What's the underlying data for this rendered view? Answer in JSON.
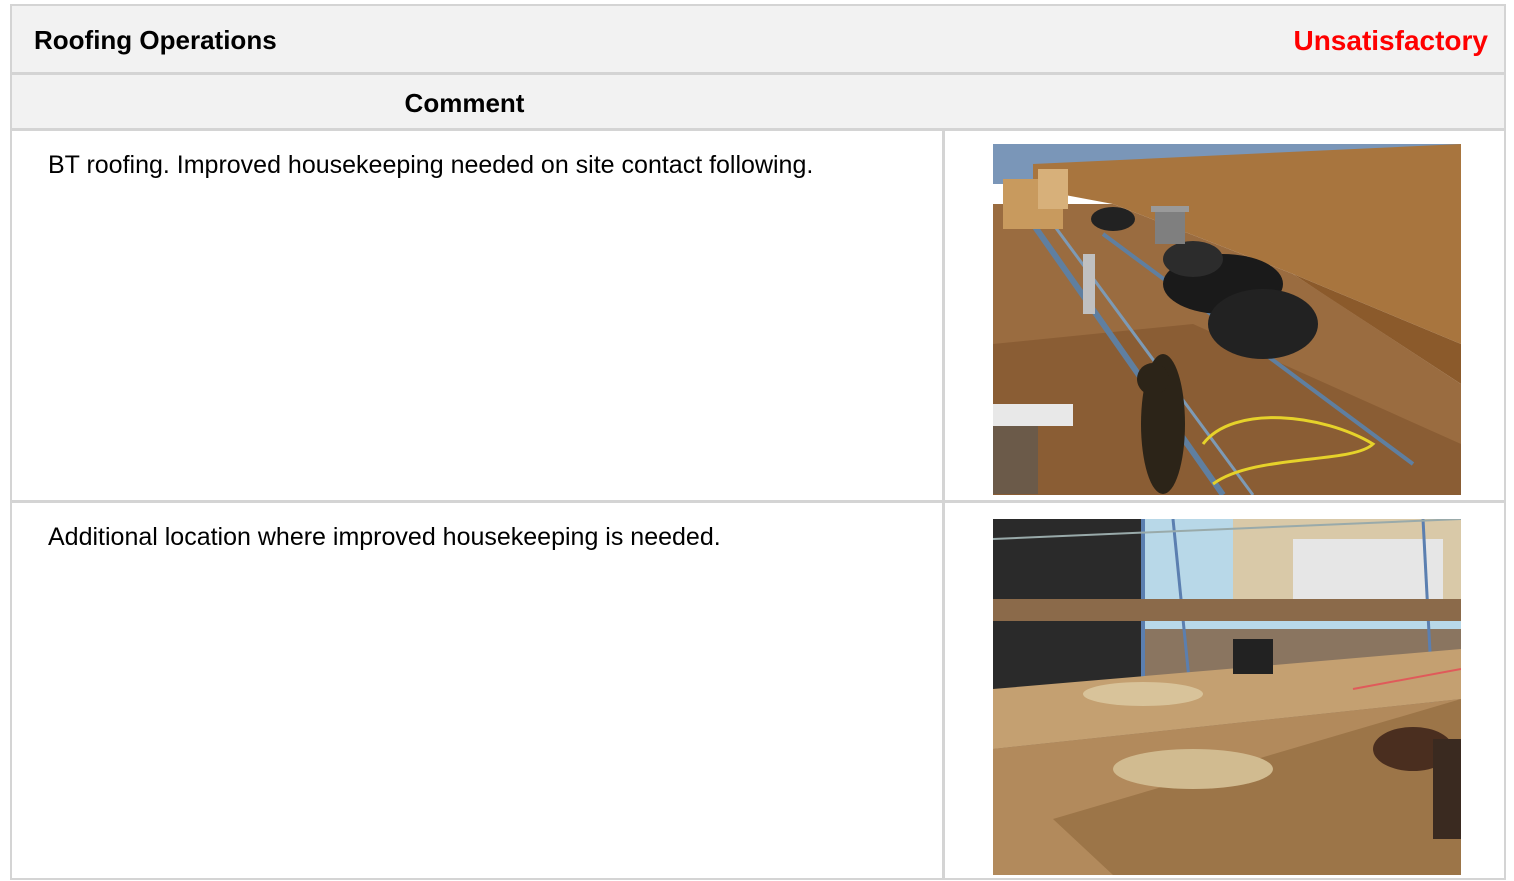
{
  "section": {
    "title": "Roofing Operations",
    "status": "Unsatisfactory",
    "status_color": "#ff0000"
  },
  "table": {
    "comment_header": "Comment",
    "rows": [
      {
        "comment": "BT roofing. Improved housekeeping needed on site contact following.",
        "photo_icon": "roof-deck-photo"
      },
      {
        "comment": "Additional location where improved housekeeping is needed.",
        "photo_icon": "scaffold-photo"
      }
    ]
  }
}
